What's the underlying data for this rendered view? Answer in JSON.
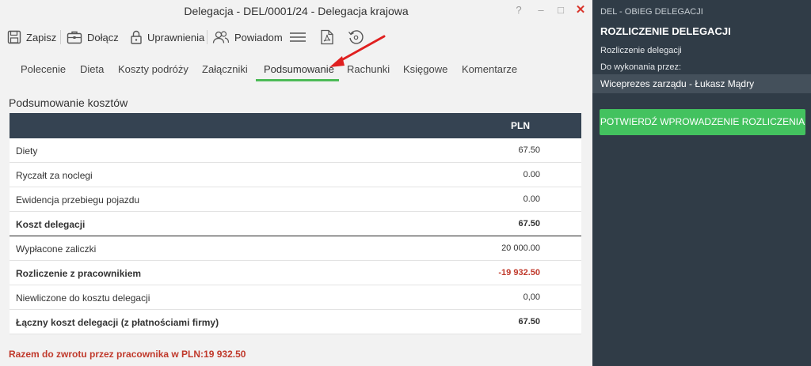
{
  "window": {
    "title": "Delegacja - DEL/0001/24 - Delegacja krajowa",
    "help": "?",
    "minimize": "–",
    "maximize": "□",
    "close": "✕"
  },
  "toolbar": {
    "save": "Zapisz",
    "attach": "Dołącz",
    "permissions": "Uprawnienia",
    "notify": "Powiadom"
  },
  "tabs": [
    {
      "label": "Polecenie"
    },
    {
      "label": "Dieta"
    },
    {
      "label": "Koszty podróży"
    },
    {
      "label": "Załączniki"
    },
    {
      "label": "Podsumowanie",
      "active": true
    },
    {
      "label": "Rachunki"
    },
    {
      "label": "Księgowe"
    },
    {
      "label": "Komentarze"
    }
  ],
  "summary": {
    "title": "Podsumowanie kosztów",
    "currency_header": "PLN",
    "rows": [
      {
        "label": "Diety",
        "value": "67.50"
      },
      {
        "label": "Ryczałt za noclegi",
        "value": "0.00"
      },
      {
        "label": "Ewidencja przebiegu pojazdu",
        "value": "0.00"
      },
      {
        "label": "Koszt delegacji",
        "value": "67.50"
      },
      {
        "label": "Wypłacone zaliczki",
        "value": "20 000.00"
      },
      {
        "label": "Rozliczenie z pracownikiem",
        "value": "-19 932.50"
      },
      {
        "label": "Niewliczone do kosztu delegacji",
        "value": "0,00"
      },
      {
        "label": "Łączny koszt delegacji (z płatnościami firmy)",
        "value": "67.50"
      }
    ],
    "note": "Razem do zwrotu przez pracownika w PLN:19 932.50"
  },
  "side": {
    "header": "DEL - OBIEG DELEGACJI",
    "title": "ROZLICZENIE DELEGACJI",
    "subtitle": "Rozliczenie delegacji",
    "assignee_label": "Do wykonania przez:",
    "assignee": "Wiceprezes zarządu - Łukasz Mądry",
    "confirm_button": "POTWIERDŹ WPROWADZENIE ROZLICZENIA"
  },
  "colors": {
    "accent": "#4cbb57",
    "header_dark": "#354352",
    "side_bg": "#303c47",
    "negative": "#c0392b",
    "arrow": "#e02020"
  },
  "icons": [
    "save-icon",
    "attach-icon",
    "lock-icon",
    "people-icon",
    "menu-icon",
    "pdf-icon",
    "history-icon",
    "red-arrow"
  ]
}
